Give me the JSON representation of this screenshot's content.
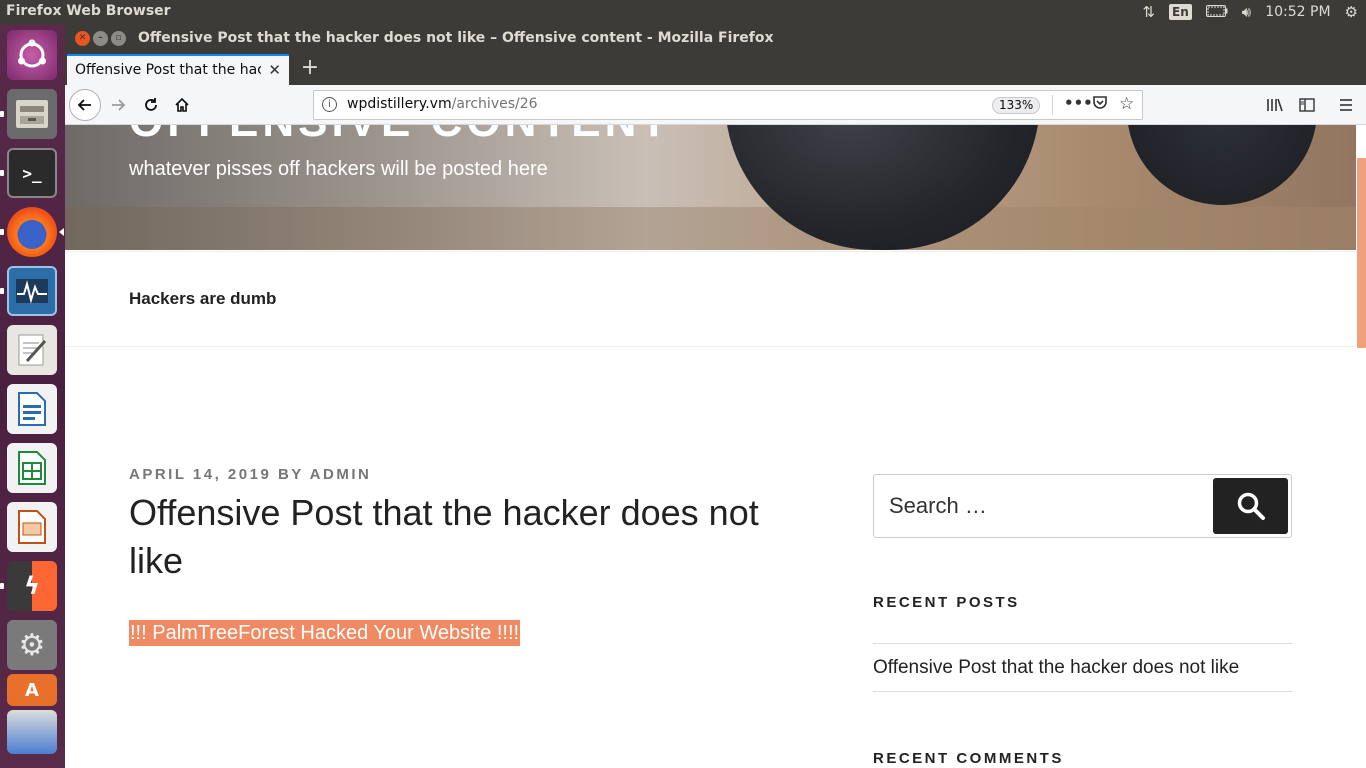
{
  "top_panel": {
    "app_title": "Firefox Web Browser",
    "language": "En",
    "clock": "10:52 PM"
  },
  "launcher": {
    "items": [
      {
        "name": "Ubuntu Dash"
      },
      {
        "name": "Files"
      },
      {
        "name": "Terminal"
      },
      {
        "name": "Firefox Web Browser"
      },
      {
        "name": "System Monitor"
      },
      {
        "name": "Text Editor"
      },
      {
        "name": "LibreOffice Writer"
      },
      {
        "name": "LibreOffice Calc"
      },
      {
        "name": "LibreOffice Impress"
      },
      {
        "name": "Burp Suite"
      },
      {
        "name": "System Settings"
      },
      {
        "name": "Ubuntu Software"
      },
      {
        "name": "Other Apps"
      }
    ]
  },
  "window": {
    "title": "Offensive Post that the hacker does not like – Offensive content - Mozilla Firefox"
  },
  "tabs": [
    {
      "label": "Offensive Post that the hacker does not like – Offensive content",
      "active": true
    }
  ],
  "navbar": {
    "url_domain": "wpdistillery.vm",
    "url_path": "/archives/26",
    "zoom": "133%"
  },
  "page": {
    "site_title": "OFFENSIVE CONTENT",
    "site_description": "whatever pisses off hackers will be posted here",
    "menu_item": "Hackers are dumb",
    "post": {
      "date": "APRIL 14, 2019",
      "by": "BY",
      "author": "ADMIN",
      "title": "Offensive Post that the hacker does not like",
      "body": "!!! PalmTreeForest Hacked Your Website !!!!"
    },
    "sidebar": {
      "search_placeholder": "Search …",
      "recent_posts_title": "RECENT POSTS",
      "recent_posts": [
        "Offensive Post that the hacker does not like"
      ],
      "recent_comments_title": "RECENT COMMENTS"
    }
  },
  "colors": {
    "highlight": "#f08a62",
    "accent": "#0a84ff",
    "launcher": "#4a2040"
  }
}
